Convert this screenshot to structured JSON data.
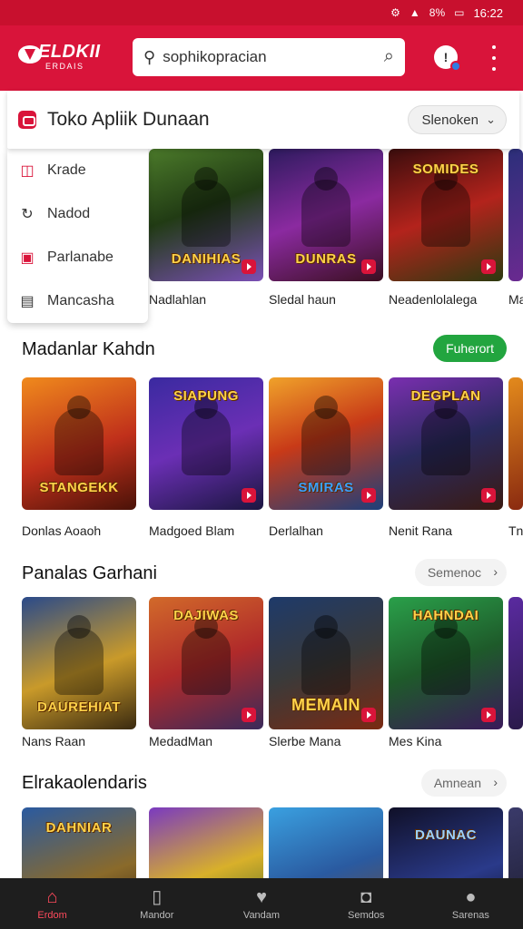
{
  "status_bar": {
    "time": "16:22",
    "battery": "8%"
  },
  "app": {
    "logo_line1": "ELDKII",
    "logo_line2": "ERDAIS"
  },
  "search": {
    "value": "sophikopracian"
  },
  "banner": {
    "title": "Toko Apliik Dunaan",
    "selector": "Slenoken"
  },
  "menu": {
    "items": [
      {
        "label": "Krade",
        "icon": "store-icon"
      },
      {
        "label": "Nadod",
        "icon": "refresh-icon"
      },
      {
        "label": "Parlanabe",
        "icon": "gift-icon"
      },
      {
        "label": "Mancasha",
        "icon": "grid-icon"
      }
    ]
  },
  "sections": [
    {
      "id": "row1",
      "title": "",
      "action": "",
      "items": [
        {
          "label": "",
          "logo": ""
        },
        {
          "label": "Nadlahlan",
          "logo": "DANIHIAS"
        },
        {
          "label": "Sledal haun",
          "logo": "DUNRAS"
        },
        {
          "label": "Neadenlolalega",
          "logo": "SOMIDES"
        },
        {
          "label": "Ma",
          "logo": ""
        }
      ]
    },
    {
      "id": "row2",
      "title": "Madanlar Kahdn",
      "action": "Fuherort",
      "items": [
        {
          "label": "Donlas Aoaoh",
          "logo": "STANGEKK"
        },
        {
          "label": "Madgoed Blam",
          "logo": "SIAPUNG"
        },
        {
          "label": "Derlalhan",
          "logo": "SMIRAS"
        },
        {
          "label": "Nenit Rana",
          "logo": "DEGPLAN"
        },
        {
          "label": "Tn",
          "logo": ""
        }
      ]
    },
    {
      "id": "row3",
      "title": "Panalas Garhani",
      "action": "Semenoc",
      "items": [
        {
          "label": "Nans Raan",
          "logo": "DAUREHIAT"
        },
        {
          "label": "MedadMan",
          "logo": "DAJIWAS"
        },
        {
          "label": "Slerbe Mana",
          "logo": "MEMAIN"
        },
        {
          "label": "Mes Kina",
          "logo": "HAHNDAI"
        },
        {
          "label": "",
          "logo": ""
        }
      ]
    },
    {
      "id": "row4",
      "title": "Elrakaolendaris",
      "action": "Amnean",
      "items": [
        {
          "label": "",
          "logo": "DAHNIAR"
        },
        {
          "label": "",
          "logo": ""
        },
        {
          "label": "",
          "logo": ""
        },
        {
          "label": "",
          "logo": "DAUNAC"
        },
        {
          "label": "",
          "logo": ""
        }
      ]
    }
  ],
  "bottom_nav": [
    {
      "label": "Erdom",
      "icon": "home-icon",
      "active": true
    },
    {
      "label": "Mandor",
      "icon": "bookmark-icon",
      "active": false
    },
    {
      "label": "Vandam",
      "icon": "shield-icon",
      "active": false
    },
    {
      "label": "Semdos",
      "icon": "gamepad-icon",
      "active": false
    },
    {
      "label": "Sarenas",
      "icon": "person-icon",
      "active": false
    }
  ],
  "colors": {
    "brand": "#d9143a",
    "accent_green": "#22a53f",
    "nav_bg": "#1e1e1e"
  }
}
